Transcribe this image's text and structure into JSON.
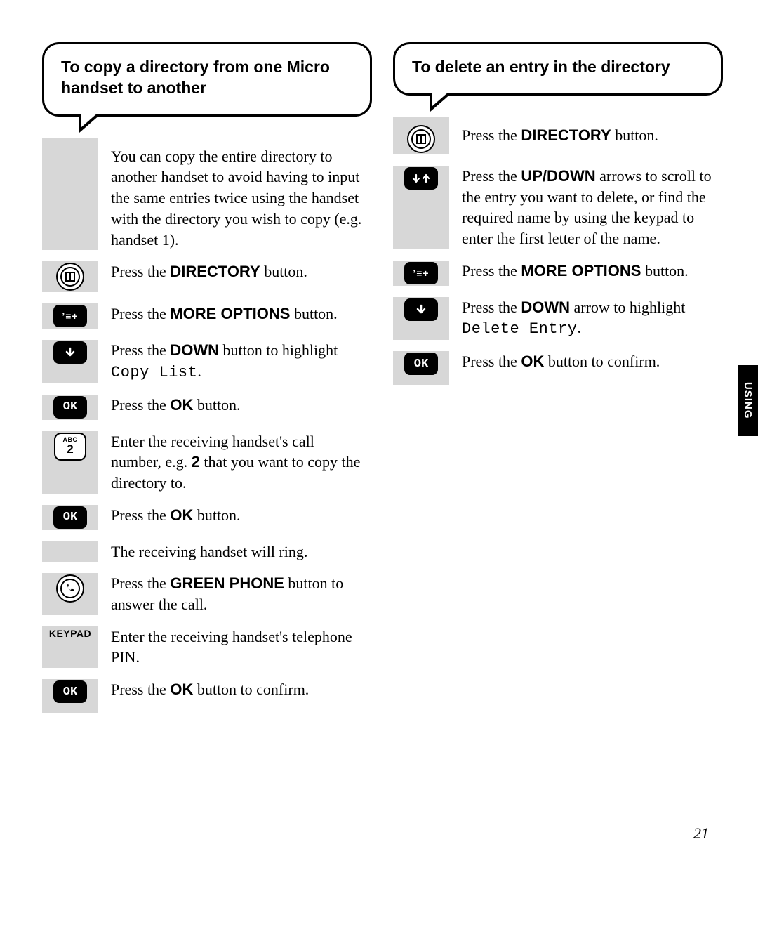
{
  "page_number": "21",
  "side_tab": "USING",
  "left": {
    "title": "To copy a directory from one Micro handset to another",
    "intro": "You can copy the entire directory to another handset to avoid having to input the same entries twice using the handset with the directory you wish to copy (e.g. handset 1).",
    "steps": [
      {
        "icon": "directory",
        "pre": "Press the ",
        "bold": "DIRECTORY",
        "post": " button."
      },
      {
        "icon": "more",
        "pre": "Press the ",
        "bold": "MORE OPTIONS",
        "post": " button."
      },
      {
        "icon": "down",
        "pre": "Press the ",
        "bold": "DOWN",
        "post": " button to highlight ",
        "mono": "Copy List",
        "post2": "."
      },
      {
        "icon": "ok",
        "pre": "Press the ",
        "bold": "OK",
        "post": " button."
      },
      {
        "icon": "key2",
        "text_parts": [
          "Enter the receiving handset's call number, e.g. ",
          "2",
          " that you want to copy the directory to."
        ]
      },
      {
        "icon": "ok",
        "pre": "Press the ",
        "bold": "OK",
        "post": " button."
      },
      {
        "icon": "",
        "plain": "The receiving handset will ring."
      },
      {
        "icon": "phone",
        "pre": "Press the ",
        "bold": "GREEN PHONE",
        "post": " button to answer the call."
      },
      {
        "icon": "keypad",
        "plain": "Enter the receiving handset's telephone PIN."
      },
      {
        "icon": "ok",
        "pre": "Press the ",
        "bold": "OK",
        "post": " button to confirm."
      }
    ]
  },
  "right": {
    "title": "To delete an entry in the directory",
    "steps": [
      {
        "icon": "directory",
        "pre": "Press the ",
        "bold": "DIRECTORY",
        "post": " button."
      },
      {
        "icon": "updown",
        "pre": "Press the ",
        "bold": "UP/DOWN",
        "post": " arrows to scroll to the entry you want to delete, or find the required name by using the keypad to enter the first letter of the name."
      },
      {
        "icon": "more",
        "pre": "Press the ",
        "bold": "MORE OPTIONS",
        "post": " button."
      },
      {
        "icon": "down",
        "pre": "Press the ",
        "bold": "DOWN",
        "post": " arrow to highlight ",
        "mono": "Delete Entry",
        "post2": "."
      },
      {
        "icon": "ok",
        "pre": "Press the ",
        "bold": "OK",
        "post": " button to confirm."
      }
    ]
  },
  "icon_labels": {
    "ok": "OK",
    "more": "’≡+",
    "keypad": "KEYPAD",
    "key_abc": "ABC",
    "key_num": "2"
  }
}
